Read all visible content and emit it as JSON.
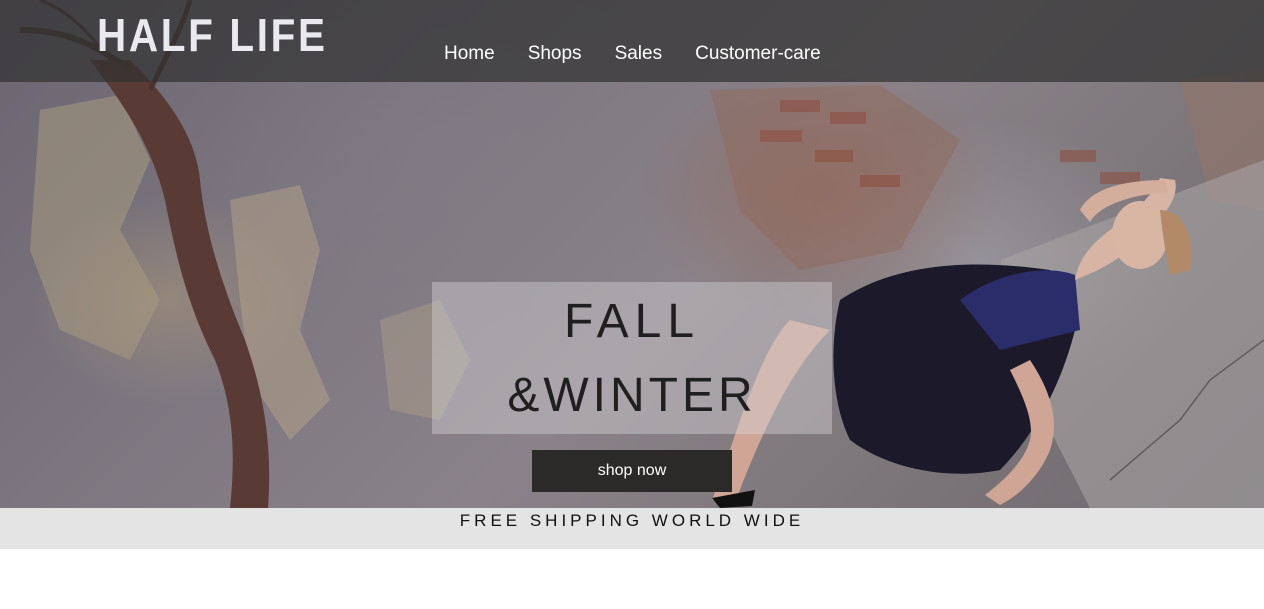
{
  "header": {
    "logo": "HALF LIFE",
    "nav": [
      {
        "label": "Home"
      },
      {
        "label": "Shops"
      },
      {
        "label": "Sales"
      },
      {
        "label": "Customer-care"
      }
    ]
  },
  "hero": {
    "promo_line1": "FALL",
    "promo_line2": "&WINTER",
    "cta_label": "shop now"
  },
  "banner": {
    "shipping_text": "FREE SHIPPING WORLD WIDE"
  },
  "colors": {
    "nav_background": "#323232",
    "cta_background": "#2b2a29",
    "strip_background": "#e4e4e4"
  }
}
